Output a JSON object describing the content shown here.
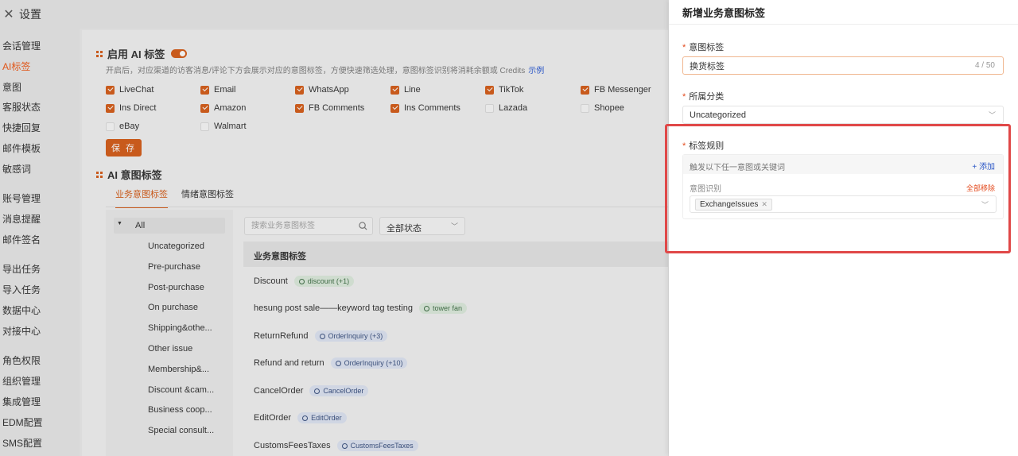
{
  "header": {
    "title": "设置",
    "close_icon": "close-icon"
  },
  "sidebar": {
    "items": [
      {
        "label": "会话管理"
      },
      {
        "label": "AI标签",
        "active": true
      },
      {
        "label": "意图"
      },
      {
        "label": "客服状态"
      },
      {
        "label": "快捷回复"
      },
      {
        "label": "邮件模板"
      },
      {
        "label": "敏感词"
      },
      {
        "label": "账号管理"
      },
      {
        "label": "消息提醒"
      },
      {
        "label": "邮件签名"
      },
      {
        "label": "导出任务"
      },
      {
        "label": "导入任务"
      },
      {
        "label": "数据中心"
      },
      {
        "label": "对接中心"
      },
      {
        "label": "角色权限"
      },
      {
        "label": "组织管理"
      },
      {
        "label": "集成管理"
      },
      {
        "label": "EDM配置"
      },
      {
        "label": "SMS配置"
      }
    ]
  },
  "ai_tag": {
    "enable_label": "启用 AI 标签",
    "enabled": true,
    "description": "开启后，对应渠道的访客消息/评论下方会展示对应的意图标签，方便快速筛选处理，意图标签识别将消耗余额或 Credits",
    "example_link": "示例",
    "channels": [
      {
        "label": "LiveChat",
        "checked": true
      },
      {
        "label": "Email",
        "checked": true
      },
      {
        "label": "WhatsApp",
        "checked": true
      },
      {
        "label": "Line",
        "checked": true
      },
      {
        "label": "TikTok",
        "checked": true
      },
      {
        "label": "FB Messenger",
        "checked": true
      },
      {
        "label": "Ins Direct",
        "checked": true
      },
      {
        "label": "Amazon",
        "checked": true
      },
      {
        "label": "FB Comments",
        "checked": true
      },
      {
        "label": "Ins Comments",
        "checked": true
      },
      {
        "label": "Lazada",
        "checked": false
      },
      {
        "label": "Shopee",
        "checked": false
      },
      {
        "label": "eBay",
        "checked": false
      },
      {
        "label": "Walmart",
        "checked": false
      }
    ],
    "save_label": "保 存"
  },
  "intent_section": {
    "title": "AI 意图标签",
    "tabs": [
      {
        "label": "业务意图标签",
        "active": true
      },
      {
        "label": "情绪意图标签",
        "active": false
      }
    ],
    "tree": {
      "all_label": "All",
      "items": [
        "Uncategorized",
        "Pre-purchase",
        "Post-purchase",
        "On purchase",
        "Shipping&othe...",
        "Other issue",
        "Membership&...",
        "Discount &cam...",
        "Business coop...",
        "Special consult..."
      ]
    },
    "search_placeholder": "搜索业务意图标签",
    "status_select": "全部状态",
    "table_header": "业务意图标签",
    "rows": [
      {
        "name": "Discount",
        "tag": "discount (+1)",
        "color": "green"
      },
      {
        "name": "hesung post sale——keyword tag testing",
        "tag": "tower fan",
        "color": "green"
      },
      {
        "name": "ReturnRefund",
        "tag": "OrderInquiry (+3)",
        "color": "blue"
      },
      {
        "name": "Refund and return",
        "tag": "OrderInquiry (+10)",
        "color": "blue"
      },
      {
        "name": "CancelOrder",
        "tag": "CancelOrder",
        "color": "blue"
      },
      {
        "name": "EditOrder",
        "tag": "EditOrder",
        "color": "blue"
      },
      {
        "name": "CustomsFeesTaxes",
        "tag": "CustomsFeesTaxes",
        "color": "blue"
      }
    ]
  },
  "drawer": {
    "title": "新增业务意图标签",
    "name_label": "意图标签",
    "name_value": "换货标签",
    "name_count": "4 / 50",
    "category_label": "所属分类",
    "category_value": "Uncategorized",
    "rule_label": "标签规则",
    "rule_hint": "触发以下任一意图或关键词",
    "add_label": "+ 添加",
    "intent_label": "意图识别",
    "remove_all_label": "全部移除",
    "selected_intent": "ExchangeIssues"
  },
  "colors": {
    "accent": "#e0571a",
    "required": "#e34a1d",
    "link": "#2a56c6",
    "highlight": "#e04848"
  }
}
